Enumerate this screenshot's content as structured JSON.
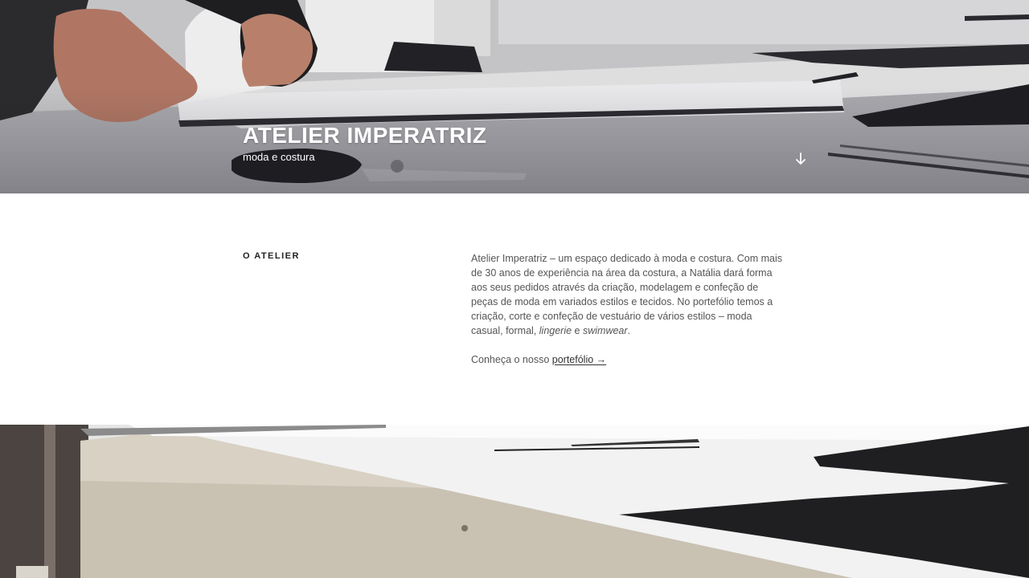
{
  "hero": {
    "title": "ATELIER IMPERATRIZ",
    "subtitle": "moda e costura",
    "scroll_icon": "arrow-down-icon",
    "image_icon": "sewing-table-photo"
  },
  "about": {
    "label": "O ATELIER",
    "p1_a": "Atelier Imperatriz – um espaço dedicado à moda e costura. Com mais de 30 anos de experiência na área da costura, a Natália dará forma aos seus pedidos através da criação, modelagem e confeção de peças de moda em variados estilos e tecidos. No portefólio temos a criação, corte e confeção de vestuário de vários estilos – moda casual, formal, ",
    "p1_em1": "lingerie",
    "p1_mid": " e ",
    "p1_em2": "swimwear",
    "p1_end": ".",
    "cta_prefix": "Conheça o nosso ",
    "cta_link": "portefólio →"
  },
  "bottom": {
    "image_icon": "fabric-on-table-photo"
  },
  "colors": {
    "text": "#555555",
    "heading": "#222222",
    "hero_text": "#ffffff",
    "fabric": "#1f1f21"
  }
}
